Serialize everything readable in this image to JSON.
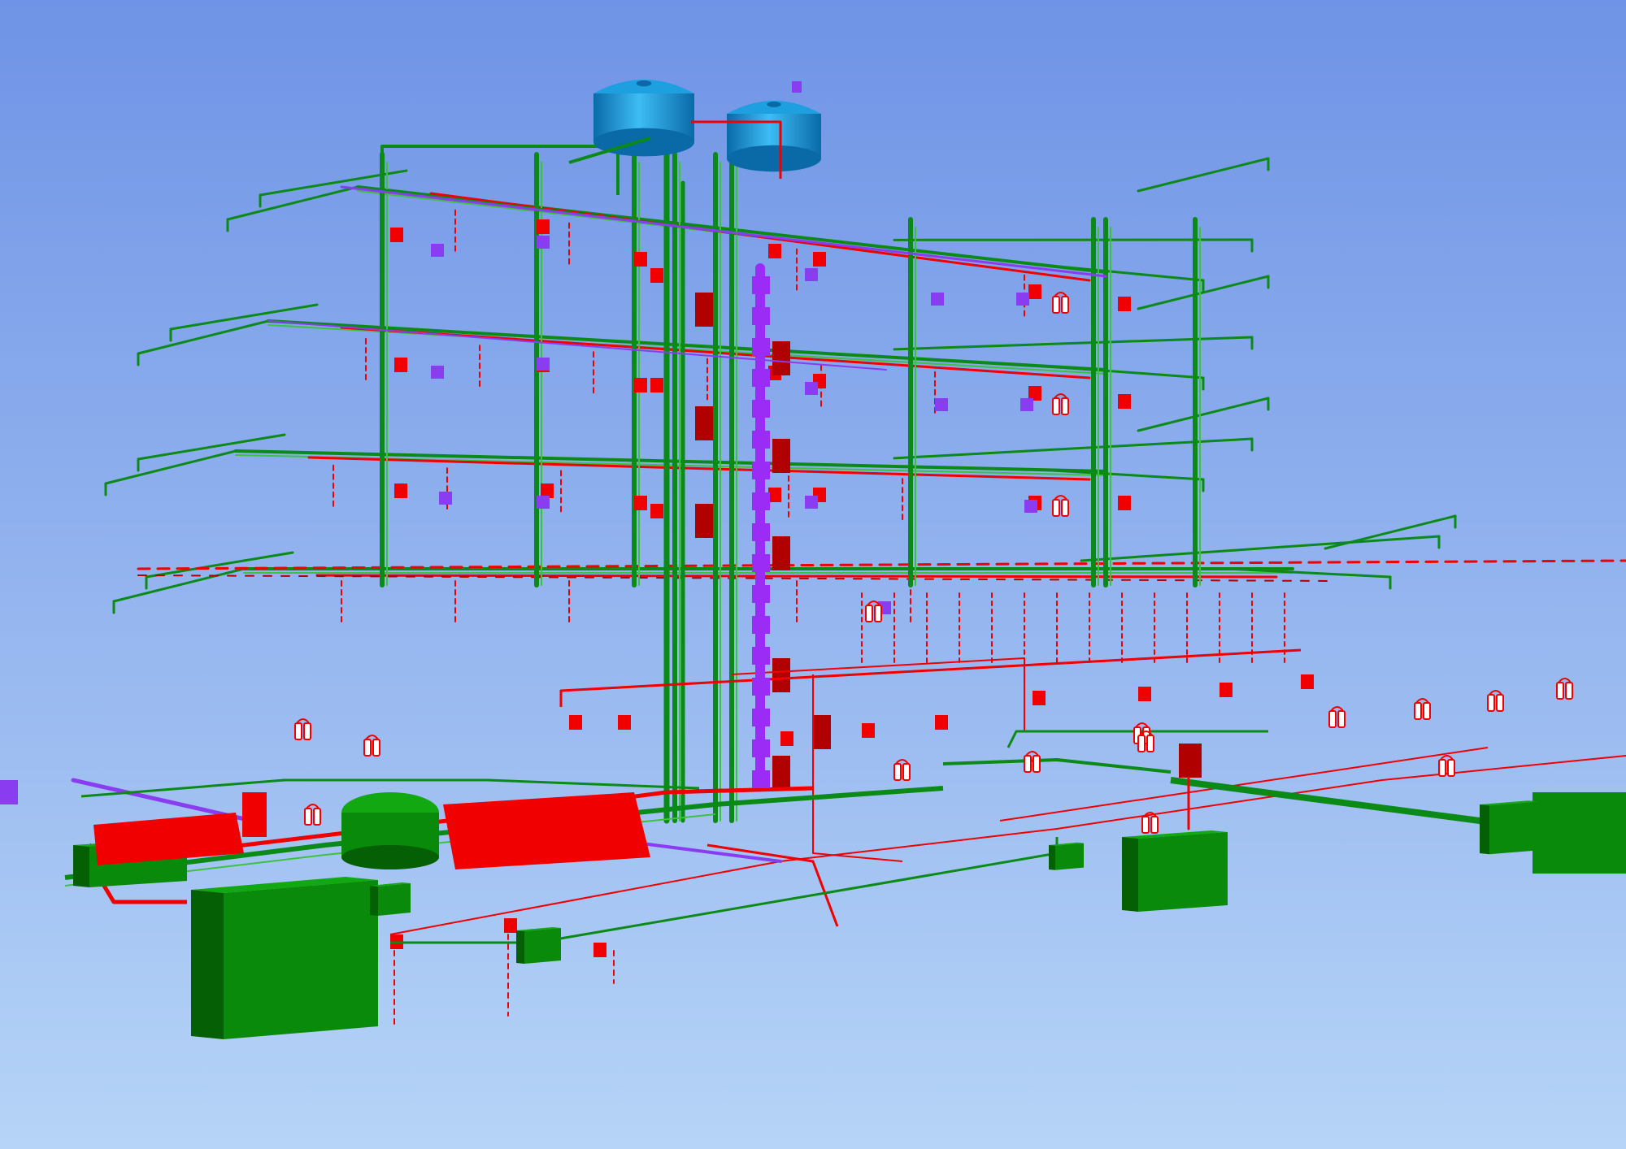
{
  "viewport": {
    "background_top": "#6f93e6",
    "background_bottom": "#b6d4f7",
    "view": "3d-isometric"
  },
  "palette": {
    "plumbing_pipe": "#0b8a17",
    "plumbing_pipe_light": "#3cc23c",
    "fire_pipe": "#f00000",
    "fire_pipe_dark": "#b00000",
    "drain_pipe": "#8a3cf0",
    "drain_riser": "#9a2cf5",
    "tank_blue": "#1e9fe0",
    "tank_blue_dark": "#0a6aa8",
    "equipment_green": "#0a8a0a",
    "equipment_green_dark": "#056005",
    "equipment_green_light": "#12a812"
  },
  "model": {
    "floor_count": 4,
    "water_tank_count": 2,
    "equipment_block_count": 5,
    "fire_extinguisher_icon": "fire-extinguisher-icon",
    "valve_icon": "valve-icon"
  }
}
